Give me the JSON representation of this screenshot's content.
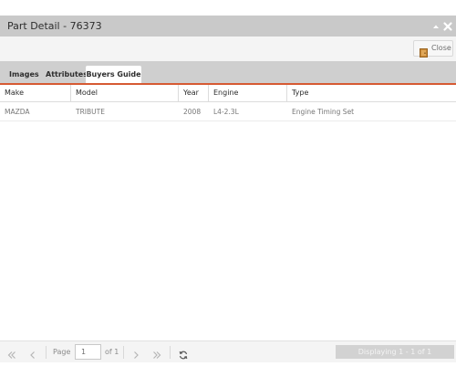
{
  "window": {
    "title": "Part Detail - 76373",
    "collapse_icon": "chevron-up-icon",
    "close_icon": "close-icon"
  },
  "toolbar": {
    "close_label": "Close",
    "close_icon": "exit-door-icon"
  },
  "tabs": [
    {
      "label": "Images",
      "active": false
    },
    {
      "label": "Attributes",
      "active": false
    },
    {
      "label": "Buyers Guide",
      "active": true
    }
  ],
  "grid": {
    "columns": [
      "Make",
      "Model",
      "Year",
      "Engine",
      "Type"
    ],
    "rows": [
      [
        "MAZDA",
        "TRIBUTE",
        "2008",
        "L4-2.3L",
        "Engine Timing Set"
      ]
    ]
  },
  "pager": {
    "page_label": "Page",
    "page_value": "1",
    "of_label": "of 1",
    "display_text": "Displaying 1 - 1 of 1"
  },
  "colors": {
    "accent": "#d65a33",
    "titlebar": "#c9c9c9",
    "tabbar": "#cfcfcf"
  }
}
